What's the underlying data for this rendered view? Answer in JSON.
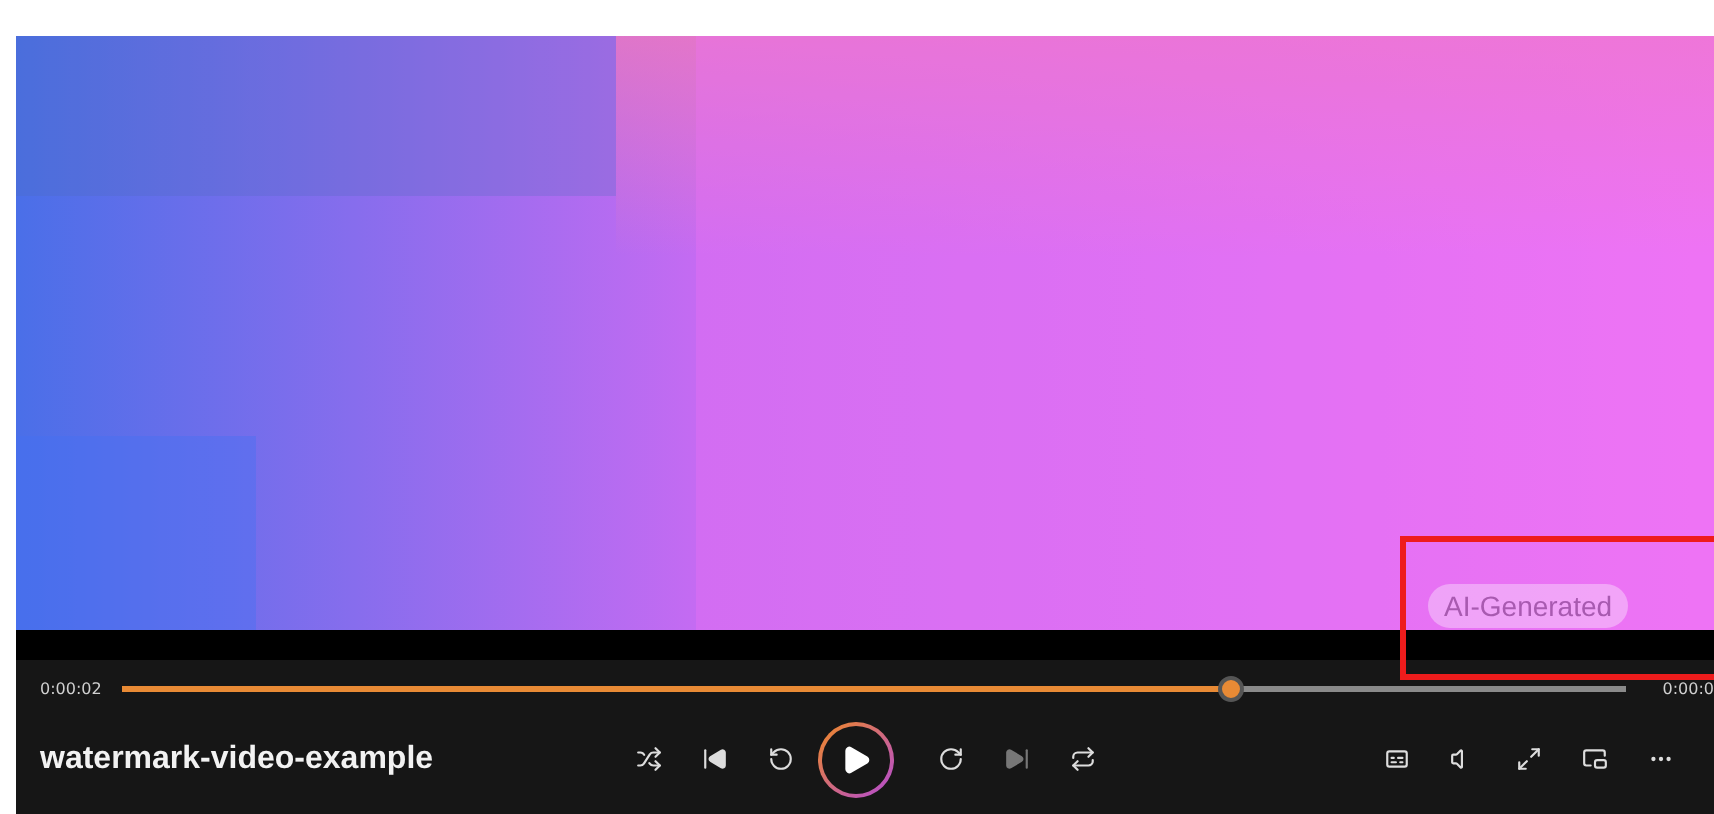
{
  "player": {
    "title": "watermark-video-example",
    "elapsed": "0:00:02",
    "remaining": "0:00:0",
    "level": 0.737,
    "playing": false
  },
  "overlay": {
    "label": "AI-Generated",
    "highlighted": true
  }
}
